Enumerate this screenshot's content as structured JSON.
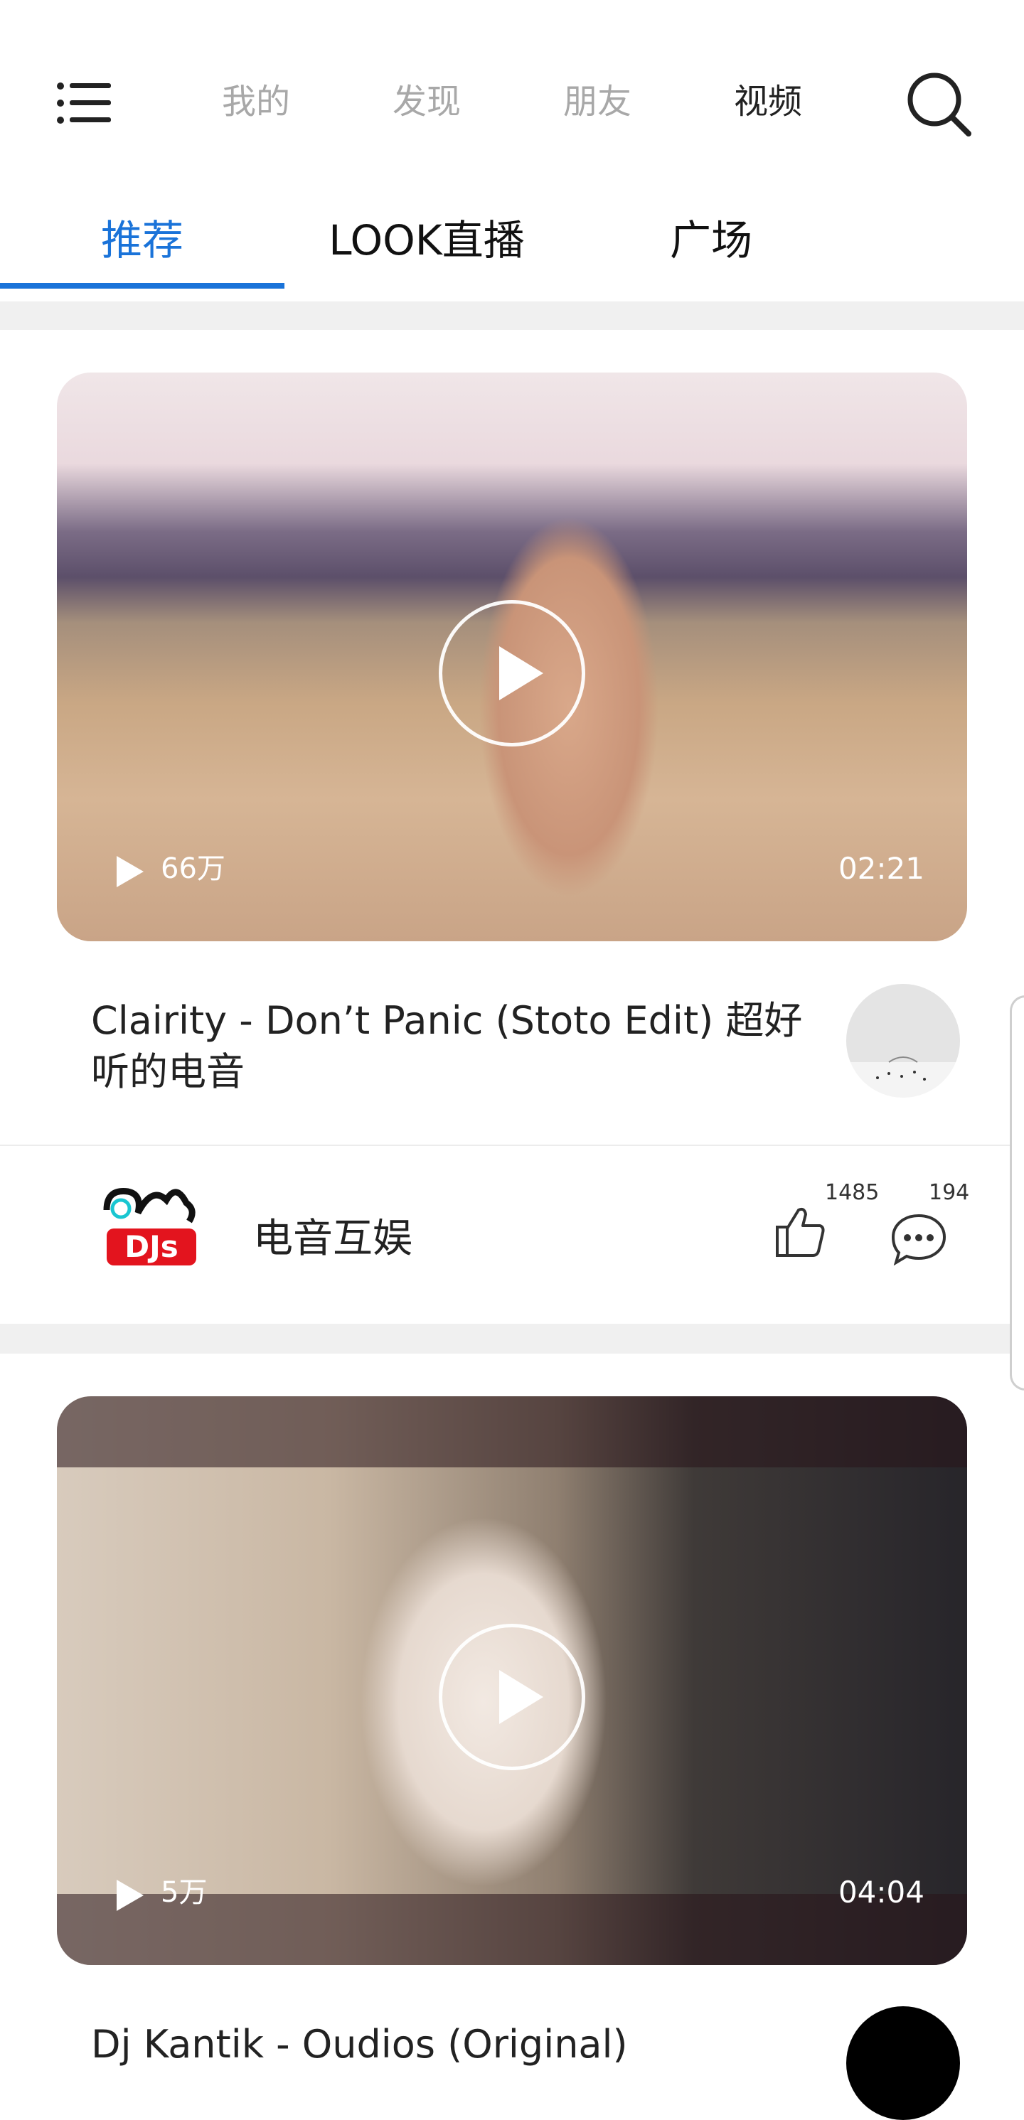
{
  "top_nav": {
    "tabs": [
      {
        "label": "我的",
        "active": false
      },
      {
        "label": "发现",
        "active": false
      },
      {
        "label": "朋友",
        "active": false
      },
      {
        "label": "视频",
        "active": true
      }
    ],
    "menu_icon": "list-menu-icon",
    "search_icon": "search-icon"
  },
  "sub_tabs": [
    {
      "label": "推荐",
      "active": true
    },
    {
      "label": "LOOK直播",
      "active": false
    },
    {
      "label": "广场",
      "active": false
    }
  ],
  "colors": {
    "accent": "#1a73d9",
    "divider": "#f0f0f0"
  },
  "videos": [
    {
      "views": "66万",
      "duration": "02:21",
      "title": "Clairity - Don’t Panic (Stoto Edit) 超好听的电音",
      "author": "电音互娱",
      "likes": "1485",
      "comments": "194"
    },
    {
      "views": "5万",
      "duration": "04:04",
      "title": "Dj Kantik - Oudios (Original)"
    }
  ]
}
